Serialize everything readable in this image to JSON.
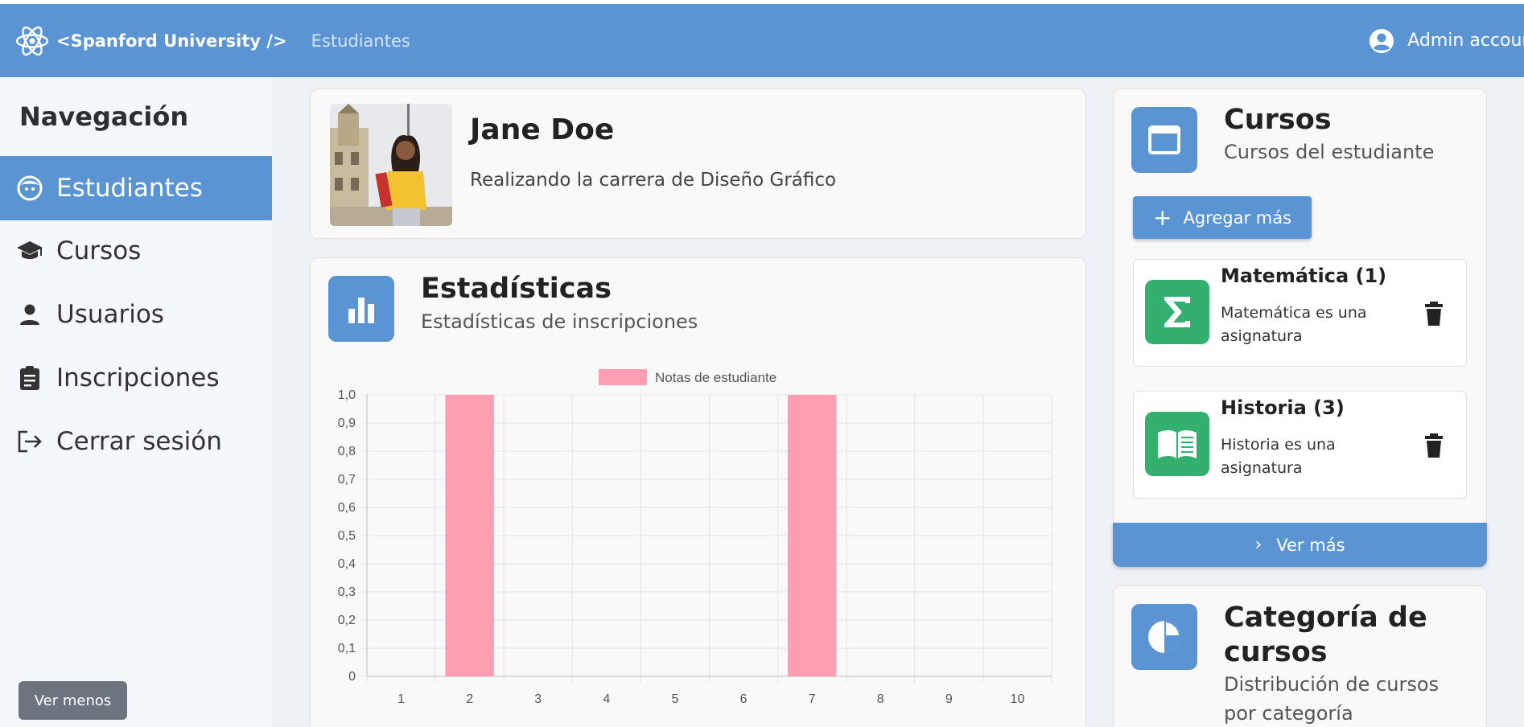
{
  "header": {
    "brand": "<Spanford University />",
    "breadcrumb": "Estudiantes",
    "account": "Admin account"
  },
  "sidebar": {
    "title": "Navegación",
    "items": [
      {
        "label": "Estudiantes",
        "icon": "face-icon",
        "active": true
      },
      {
        "label": "Cursos",
        "icon": "graduation-cap-icon",
        "active": false
      },
      {
        "label": "Usuarios",
        "icon": "person-icon",
        "active": false
      },
      {
        "label": "Inscripciones",
        "icon": "clipboard-icon",
        "active": false
      },
      {
        "label": "Cerrar sesión",
        "icon": "logout-icon",
        "active": false
      }
    ],
    "collapse_button": "Ver menos"
  },
  "profile": {
    "name": "Jane Doe",
    "description": "Realizando la carrera de Diseño Gráfico"
  },
  "stats": {
    "title": "Estadísticas",
    "subtitle": "Estadísticas de inscripciones"
  },
  "chart_data": {
    "type": "bar",
    "categories": [
      "1",
      "2",
      "3",
      "4",
      "5",
      "6",
      "7",
      "8",
      "9",
      "10"
    ],
    "series": [
      {
        "name": "Notas de estudiante",
        "values": [
          0,
          1,
          0,
          0,
          0,
          0,
          1,
          0,
          0,
          0
        ],
        "color": "#ff9db3"
      }
    ],
    "ylim": [
      0,
      1
    ],
    "yticks": [
      "0",
      "0,1",
      "0,2",
      "0,3",
      "0,4",
      "0,5",
      "0,6",
      "0,7",
      "0,8",
      "0,9",
      "1,0"
    ],
    "grid": true,
    "legend_position": "top"
  },
  "courses": {
    "title": "Cursos",
    "subtitle": "Cursos del estudiante",
    "add_button": "Agregar más",
    "items": [
      {
        "title": "Matemática (1)",
        "description": "Matemática es una asignatura",
        "icon": "sigma-icon"
      },
      {
        "title": "Historia (3)",
        "description": "Historia es una asignatura",
        "icon": "book-icon"
      }
    ],
    "more_button": "Ver más"
  },
  "categories": {
    "title": "Categoría de cursos",
    "subtitle": "Distribución de cursos por categoría"
  },
  "colors": {
    "primary": "#5a94d3",
    "sidebar_bg": "#f4f7fb",
    "course_icon": "#33b06d",
    "bar": "#ff9db3"
  }
}
